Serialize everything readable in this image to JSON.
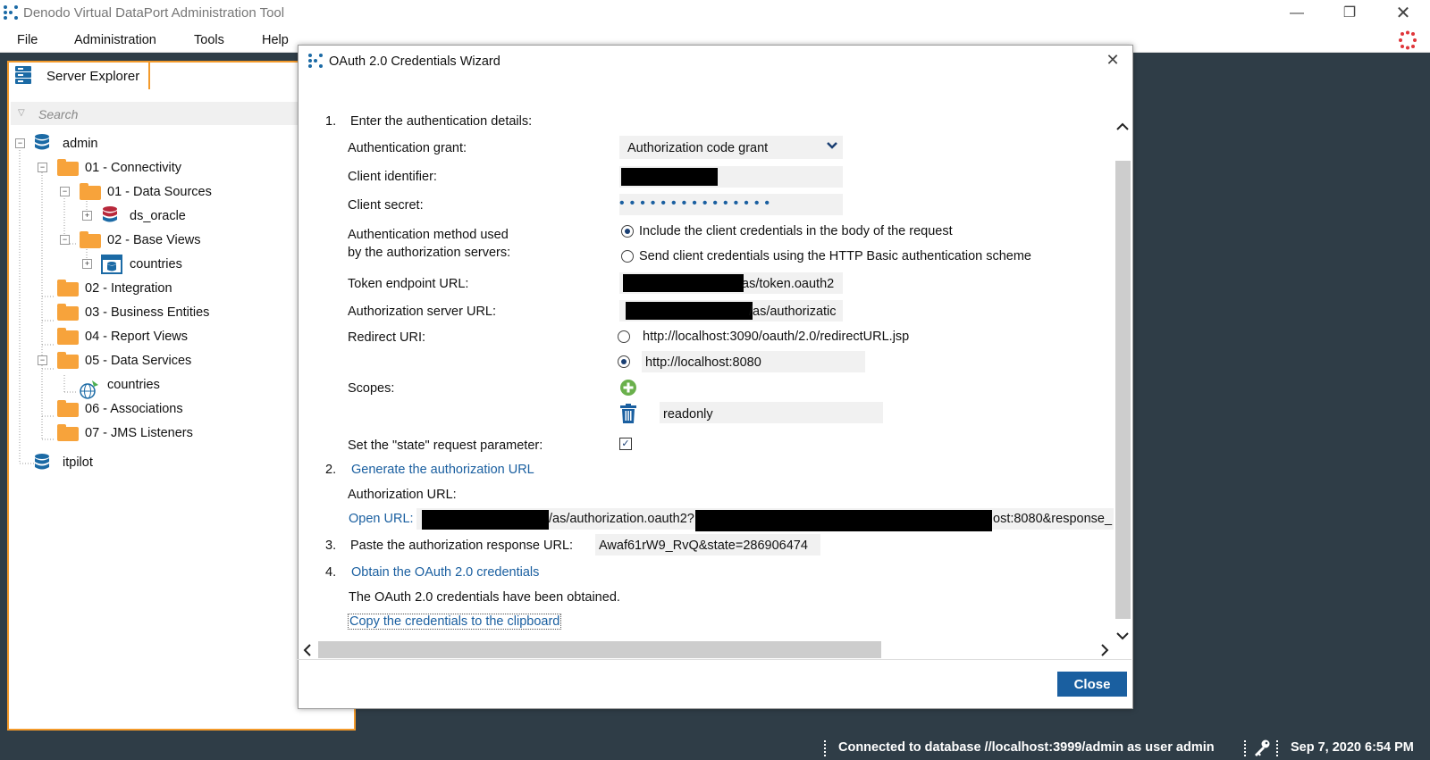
{
  "window": {
    "title": "Denodo Virtual DataPort Administration Tool"
  },
  "menu": {
    "file": "File",
    "administration": "Administration",
    "tools": "Tools",
    "help": "Help"
  },
  "explorer": {
    "tab_label": "Server Explorer",
    "search_placeholder": "Search",
    "tree": {
      "admin": "admin",
      "connectivity": "01 - Connectivity",
      "data_sources": "01 - Data Sources",
      "ds_oracle": "ds_oracle",
      "base_views": "02 - Base Views",
      "countries_view": "countries",
      "integration": "02 - Integration",
      "business_entities": "03 - Business Entities",
      "report_views": "04 - Report Views",
      "data_services": "05 - Data Services",
      "countries_service": "countries",
      "associations": "06 - Associations",
      "jms_listeners": "07 - JMS Listeners",
      "itpilot": "itpilot"
    }
  },
  "dialog": {
    "title": "OAuth 2.0 Credentials Wizard",
    "step1_num": "1.",
    "step1": "Enter the authentication details:",
    "auth_grant_label": "Authentication grant:",
    "auth_grant_value": "Authorization code grant",
    "client_id_label": "Client identifier:",
    "client_secret_label": "Client secret:",
    "client_secret_dots": "•••••••••••••••",
    "auth_method_label_1": "Authentication method used",
    "auth_method_label_2": "by the authorization servers:",
    "auth_method_option_1": "Include the client credentials in the body of the request",
    "auth_method_option_2": "Send client credentials using the HTTP Basic authentication scheme",
    "token_url_label": "Token endpoint URL:",
    "token_url_suffix": "as/token.oauth2",
    "auth_server_url_label": "Authorization server URL:",
    "auth_server_url_suffix": "/as/authorizatic",
    "redirect_uri_label": "Redirect URI:",
    "redirect_option_1": "http://localhost:3090/oauth/2.0/redirectURL.jsp",
    "redirect_option_2": "http://localhost:8080",
    "scopes_label": "Scopes:",
    "scope_value": "readonly",
    "state_label": "Set the \"state\" request parameter:",
    "step2_num": "2.",
    "step2_link": "Generate the authorization URL",
    "auth_url_label": "Authorization URL:",
    "open_url_link": "Open URL:",
    "open_url_part_1": "/as/authorization.oauth2?",
    "open_url_part_2": "ost:8080&response_",
    "step3_num": "3.",
    "step3": "Paste the authorization response URL:",
    "response_url_value": "Awaf61rW9_RvQ&state=286906474",
    "step4_num": "4.",
    "step4_link": "Obtain the OAuth 2.0 credentials",
    "obtained_text": "The OAuth 2.0 credentials have been obtained.",
    "copy_link": "Copy the credentials to the clipboard",
    "close_button": "Close"
  },
  "status": {
    "connection": "Connected to database //localhost:3999/admin as user admin",
    "datetime": "Sep 7, 2020 6:54 PM"
  }
}
